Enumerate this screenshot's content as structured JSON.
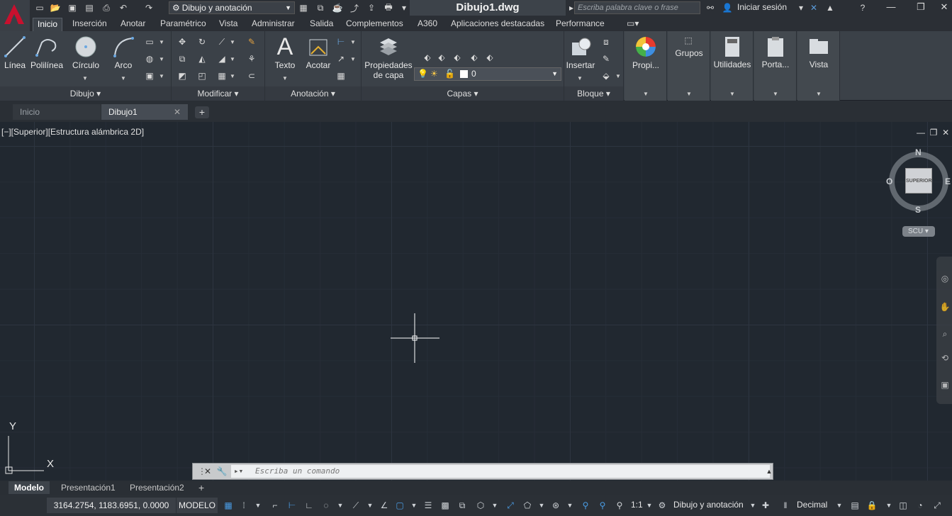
{
  "window": {
    "doc_title": "Dibujo1.dwg",
    "workspace": "Dibujo y anotación",
    "search_placeholder": "Escriba palabra clave o frase",
    "signin": "Iniciar sesión"
  },
  "ribbon_tabs": [
    "Inicio",
    "Inserción",
    "Anotar",
    "Paramétrico",
    "Vista",
    "Administrar",
    "Salida",
    "Complementos",
    "A360",
    "Aplicaciones destacadas",
    "Performance"
  ],
  "panels": {
    "dibujo": {
      "title": "Dibujo",
      "tools": [
        "Línea",
        "Polilínea",
        "Círculo",
        "Arco"
      ]
    },
    "modificar": {
      "title": "Modificar"
    },
    "anotacion": {
      "title": "Anotación",
      "tools": [
        "Texto",
        "Acotar"
      ]
    },
    "capas": {
      "title": "Capas",
      "props_line1": "Propiedades",
      "props_line2": "de capa",
      "current_layer": "0"
    },
    "bloque": {
      "title": "Bloque",
      "tools": [
        "Insertar"
      ]
    },
    "extra": [
      "Propi...",
      "Grupos",
      "Utilidades",
      "Porta...",
      "Vista"
    ]
  },
  "file_tabs": {
    "start": "Inicio",
    "current": "Dibujo1"
  },
  "viewport": {
    "label": "[−][Superior][Estructura alámbrica 2D]",
    "cube_face": "SUPERIOR",
    "compass": {
      "n": "N",
      "s": "S",
      "e": "E",
      "w": "O"
    },
    "ucs_button": "SCU",
    "ucs_x": "X",
    "ucs_y": "Y"
  },
  "command": {
    "placeholder": "Escriba un comando"
  },
  "layout_tabs": [
    "Modelo",
    "Presentación1",
    "Presentación2"
  ],
  "status": {
    "coords": "3164.2754, 1183.6951, 0.0000",
    "space": "MODELO",
    "scale": "1:1",
    "workspace": "Dibujo y anotación",
    "units": "Decimal"
  },
  "colors": {
    "accent": "#c8102e",
    "canvas": "#212830",
    "blue_icon": "#4a9de6"
  }
}
